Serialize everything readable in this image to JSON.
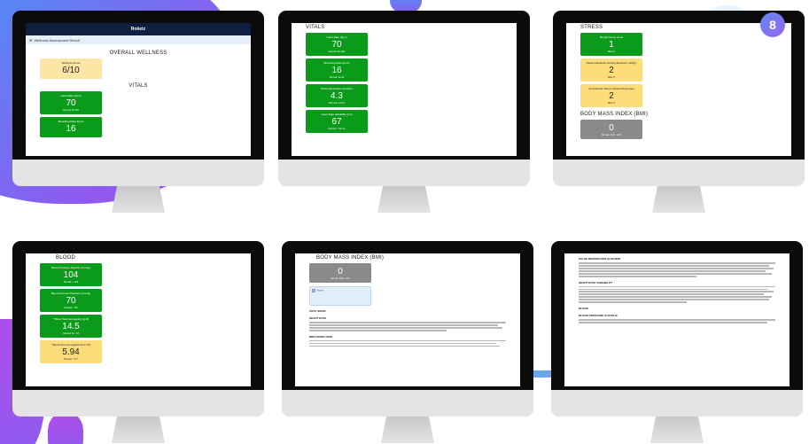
{
  "badge": "8",
  "screens": {
    "s1": {
      "app_title": "Roketz",
      "report_title": "Wellness Assessment Result",
      "info_lines": [
        "",
        ""
      ],
      "section_overall": "OVERALL WELLNESS",
      "wellness": {
        "label": "Wellness Score",
        "value": "6/10",
        "range": ""
      },
      "section_vitals": "VITALS",
      "cards": [
        {
          "label": "Heart Rate (bpm)",
          "value": "70",
          "range": "Normal: 60-100"
        },
        {
          "label": "Breathing Rate (bpm)",
          "value": "16",
          "range": ""
        }
      ]
    },
    "s2": {
      "section": "VITALS",
      "cards": [
        {
          "label": "Heart Rate (bpm)",
          "value": "70",
          "range": "Normal: 60-100"
        },
        {
          "label": "Breathing Rate (bpm)",
          "value": "16",
          "range": "Normal: 12-20"
        },
        {
          "label": "Pulse-Respiration Quotient",
          "value": "4.3",
          "range": "Normal: 4.0-5.0"
        },
        {
          "label": "Heart Rate Variability (ms)",
          "value": "67",
          "range": "Normal: > 50 ms"
        }
      ]
    },
    "s3": {
      "section_stress": "STRESS",
      "cards": [
        {
          "label": "Mental Stress Level",
          "value": "1",
          "range": "Max: 5",
          "color": "green"
        },
        {
          "label": "Parasympathetic Activity (Recovery Ability)",
          "value": "2",
          "range": "Max: 5",
          "color": "yellow"
        },
        {
          "label": "Sympathetic Stress (Stress Response)",
          "value": "2",
          "range": "Max: 5",
          "color": "yellow"
        }
      ],
      "section_bmi": "BODY MASS INDEX (BMI)",
      "bmi": {
        "label": "",
        "value": "0",
        "range": "Normal: 18.5 - 24.9"
      }
    },
    "s4": {
      "section": "BLOOD",
      "cards": [
        {
          "label": "Blood Pressure Systolic (mmHg)",
          "value": "104",
          "range": "Normal: < 120",
          "color": "green"
        },
        {
          "label": "Blood Pressure Diastolic (mmHg)",
          "value": "70",
          "range": "Normal: < 80",
          "color": "green"
        },
        {
          "label": "* Blood Test Hemoglobin (g/dl)",
          "value": "14.5",
          "range": "Normal: 12 - 18",
          "color": "green"
        },
        {
          "label": "* Blood Test Hemoglobin A1C (%)",
          "value": "5.94",
          "range": "Normal: < 5.7",
          "color": "yellow"
        }
      ]
    },
    "s5": {
      "section": "BODY MASS INDEX (BMI)",
      "bmi": {
        "value": "0",
        "range": "Normal: 18.5 - 24.9"
      },
      "notice_title": "Notice",
      "section_vitals": "VITAL SIGNS",
      "sub_heart": "HEART RATE",
      "sub_breathing": "BREATHING RATE"
    },
    "s6": {
      "sub_prq": "PULSE-RESPIRATION QUOTIENT",
      "sub_hrv": "HEART RATE VARIABILITY",
      "section_blood": "BLOOD",
      "sub_bp": "BLOOD PRESSURE SYSTOLIC"
    }
  }
}
